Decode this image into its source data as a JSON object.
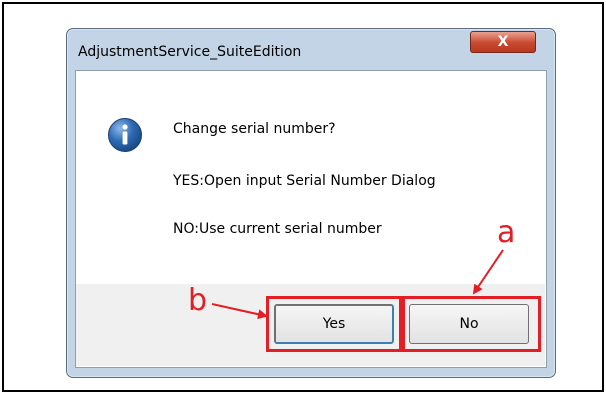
{
  "window": {
    "title": "AdjustmentService_SuiteEdition",
    "close_label": "X"
  },
  "message": {
    "question": "Change serial number?",
    "yes_line": "YES:Open input Serial Number Dialog",
    "no_line": "NO:Use current serial number"
  },
  "buttons": {
    "yes_label": "Yes",
    "no_label": "No"
  },
  "callouts": {
    "a": "a",
    "b": "b"
  },
  "colors": {
    "callout": "#e31e24",
    "info_icon": "#2e6bb6"
  },
  "icons": {
    "message_icon": "info-icon"
  }
}
